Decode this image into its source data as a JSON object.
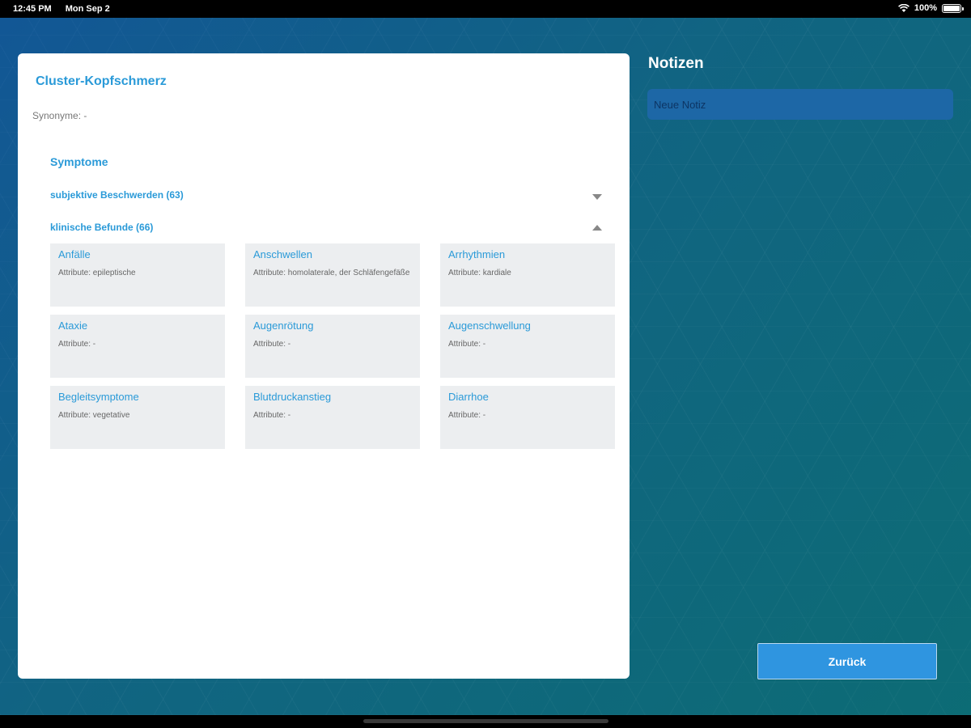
{
  "status_bar": {
    "time": "12:45 PM",
    "date": "Mon Sep 2",
    "battery": "100%"
  },
  "detail": {
    "title": "Cluster-Kopfschmerz",
    "synonyms": "Synonyme: -",
    "section_title": "Symptome",
    "groups": [
      {
        "label": "subjektive Beschwerden (63)",
        "expanded": false
      },
      {
        "label": "klinische Befunde (66)",
        "expanded": true
      }
    ],
    "findings": [
      {
        "name": "Anfälle",
        "attribute": "Attribute: epileptische"
      },
      {
        "name": "Anschwellen",
        "attribute": "Attribute: homolaterale, der Schläfengefäße"
      },
      {
        "name": "Arrhythmien",
        "attribute": "Attribute: kardiale"
      },
      {
        "name": "Ataxie",
        "attribute": "Attribute: -"
      },
      {
        "name": "Augenrötung",
        "attribute": "Attribute: -"
      },
      {
        "name": "Augenschwellung",
        "attribute": "Attribute: -"
      },
      {
        "name": "Begleitsymptome",
        "attribute": "Attribute: vegetative"
      },
      {
        "name": "Blutdruckanstieg",
        "attribute": "Attribute: -"
      },
      {
        "name": "Diarrhoe",
        "attribute": "Attribute: -"
      }
    ]
  },
  "notes": {
    "title": "Notizen",
    "placeholder": "Neue Notiz"
  },
  "actions": {
    "back_label": "Zurück"
  },
  "colors": {
    "accent": "#2a9ad8",
    "button": "#2f95e0",
    "note_field": "#1d67a6"
  }
}
